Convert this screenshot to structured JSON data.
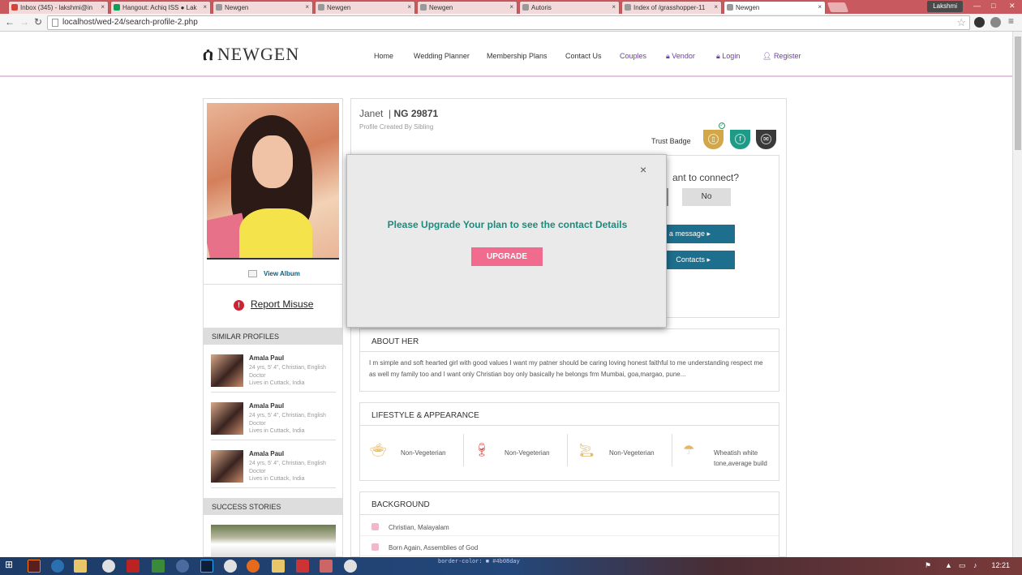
{
  "browser": {
    "tabs": [
      {
        "label": "Inbox (345) - lakshmi@in",
        "icon_color": "#d44638"
      },
      {
        "label": "Hangout: Achiq ISS ● Lak",
        "icon_color": "#0f9d58"
      },
      {
        "label": "Newgen",
        "icon_color": "#999999"
      },
      {
        "label": "Newgen",
        "icon_color": "#999999"
      },
      {
        "label": "Newgen",
        "icon_color": "#999999"
      },
      {
        "label": "Autoris",
        "icon_color": "#999999"
      },
      {
        "label": "Index of /grasshopper-11",
        "icon_color": "#999999"
      },
      {
        "label": "Newgen",
        "icon_color": "#999999"
      }
    ],
    "user": "Lakshmi",
    "url": "localhost/wed-24/search-profile-2.php"
  },
  "site": {
    "logo": "NEWGEN",
    "nav": [
      {
        "label": "Home"
      },
      {
        "label": "Wedding Planner"
      },
      {
        "label": "Membership Plans"
      },
      {
        "label": "Contact Us"
      },
      {
        "label": "Couples"
      },
      {
        "label": "Vendor"
      },
      {
        "label": "Login"
      },
      {
        "label": "Register"
      }
    ]
  },
  "sidebar": {
    "view_album": "View Album",
    "report_misuse": "Report Misuse",
    "similar_title": "SIMILAR PROFILES",
    "similar": [
      {
        "name": "Amala Paul",
        "details": "24 yrs, 5' 4\", Christian, English Doctor",
        "location": "Lives in Cuttack, India"
      },
      {
        "name": "Amala Paul",
        "details": "24 yrs, 5' 4\", Christian, English Doctor",
        "location": "Lives in Cuttack, India"
      },
      {
        "name": "Amala Paul",
        "details": "24 yrs, 5' 4\", Christian, English Doctor",
        "location": "Lives in Cuttack, India"
      }
    ],
    "stories_title": "SUCCESS STORIES"
  },
  "profile": {
    "name": "Janet",
    "id": "NG 29871",
    "created_by": "Profile Created By Sibling",
    "trust_badge": "Trust Badge",
    "connect_question": "ant to connect?",
    "no_label": "No",
    "message_label": "a message",
    "contacts_label": "Contacts",
    "about_title": "ABOUT HER",
    "about_text": "I m simple and soft hearted girl with good values I want my patner should be caring loving honest faithful to me understanding respect me as well my family too and I want only Christian boy only basically he belongs frm Mumbai, goa,margao, pune...",
    "lifestyle_title": "LIFESTYLE & APPEARANCE",
    "lifestyle": [
      {
        "label": "Non-Vegeterian",
        "icon": "food-icon"
      },
      {
        "label": "Non-Vegeterian",
        "icon": "drink-icon"
      },
      {
        "label": "Non-Vegeterian",
        "icon": "smoke-icon"
      },
      {
        "label": "Wheatish white tone,average build",
        "icon": "body-icon"
      }
    ],
    "background_title": "BACKGROUND",
    "background": [
      {
        "label": "Christian, Malayalam",
        "icon": "book-icon"
      },
      {
        "label": "Born Again, Assemblies of God",
        "icon": "people-icon"
      }
    ]
  },
  "modal": {
    "close": "×",
    "message": "Please Upgrade Your plan to see the contact Details",
    "button": "UPGRADE"
  },
  "taskbar": {
    "time": "12:21",
    "code_snippet": "border-color: ■ #4b08day"
  }
}
